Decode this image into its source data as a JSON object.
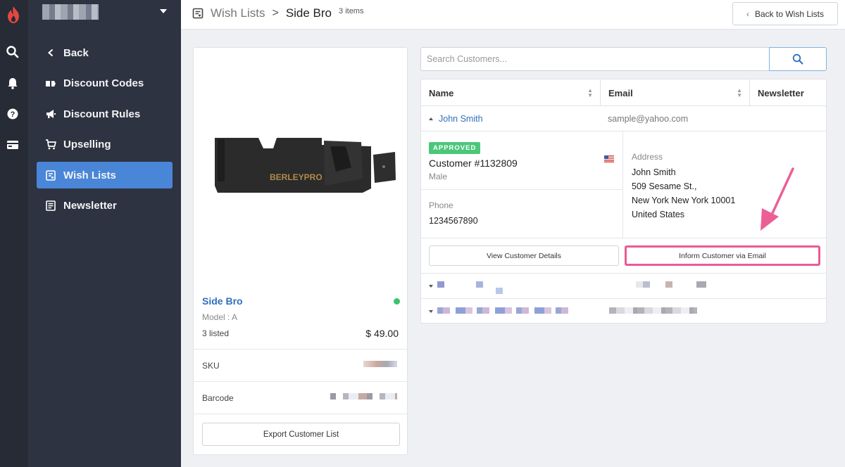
{
  "header": {
    "breadcrumb_parent": "Wish Lists",
    "breadcrumb_separator": ">",
    "breadcrumb_current": "Side Bro",
    "item_count": "3 items",
    "back_button": "Back to Wish Lists"
  },
  "sidebar": {
    "items": [
      {
        "label": "Back",
        "icon": "chevron-left-icon"
      },
      {
        "label": "Discount Codes",
        "icon": "tag-icon"
      },
      {
        "label": "Discount Rules",
        "icon": "megaphone-icon"
      },
      {
        "label": "Upselling",
        "icon": "cart-icon"
      },
      {
        "label": "Wish Lists",
        "icon": "wishlist-icon",
        "active": true
      },
      {
        "label": "Newsletter",
        "icon": "newsletter-icon"
      }
    ]
  },
  "rail": {
    "icons": [
      "logo-icon",
      "search-icon",
      "bell-icon",
      "help-icon",
      "register-icon"
    ],
    "brand_color": "#e4473f"
  },
  "product": {
    "name": "Side Bro",
    "model": "Model : A",
    "listed": "3 listed",
    "price": "$ 49.00",
    "sku_label": "SKU",
    "barcode_label": "Barcode",
    "export_button": "Export Customer List",
    "stock_status_color": "#3bc46b"
  },
  "search": {
    "placeholder": "Search Customers..."
  },
  "table": {
    "columns": [
      "Name",
      "Email",
      "Newsletter"
    ],
    "rows": [
      {
        "name": "John Smith",
        "email": "sample@yahoo.com",
        "expanded": true,
        "status_badge": "APPROVED",
        "customer_id": "Customer #1132809",
        "gender": "Male",
        "phone_label": "Phone",
        "phone": "1234567890",
        "address_label": "Address",
        "address_lines": [
          "John Smith",
          "509 Sesame St.,",
          "New York New York 10001",
          "United States"
        ],
        "view_button": "View Customer Details",
        "inform_button": "Inform Customer via Email"
      }
    ]
  },
  "colors": {
    "accent": "#4a86d8",
    "link": "#2f6fbd",
    "approved": "#4cc77a",
    "highlight": "#e95b93"
  }
}
